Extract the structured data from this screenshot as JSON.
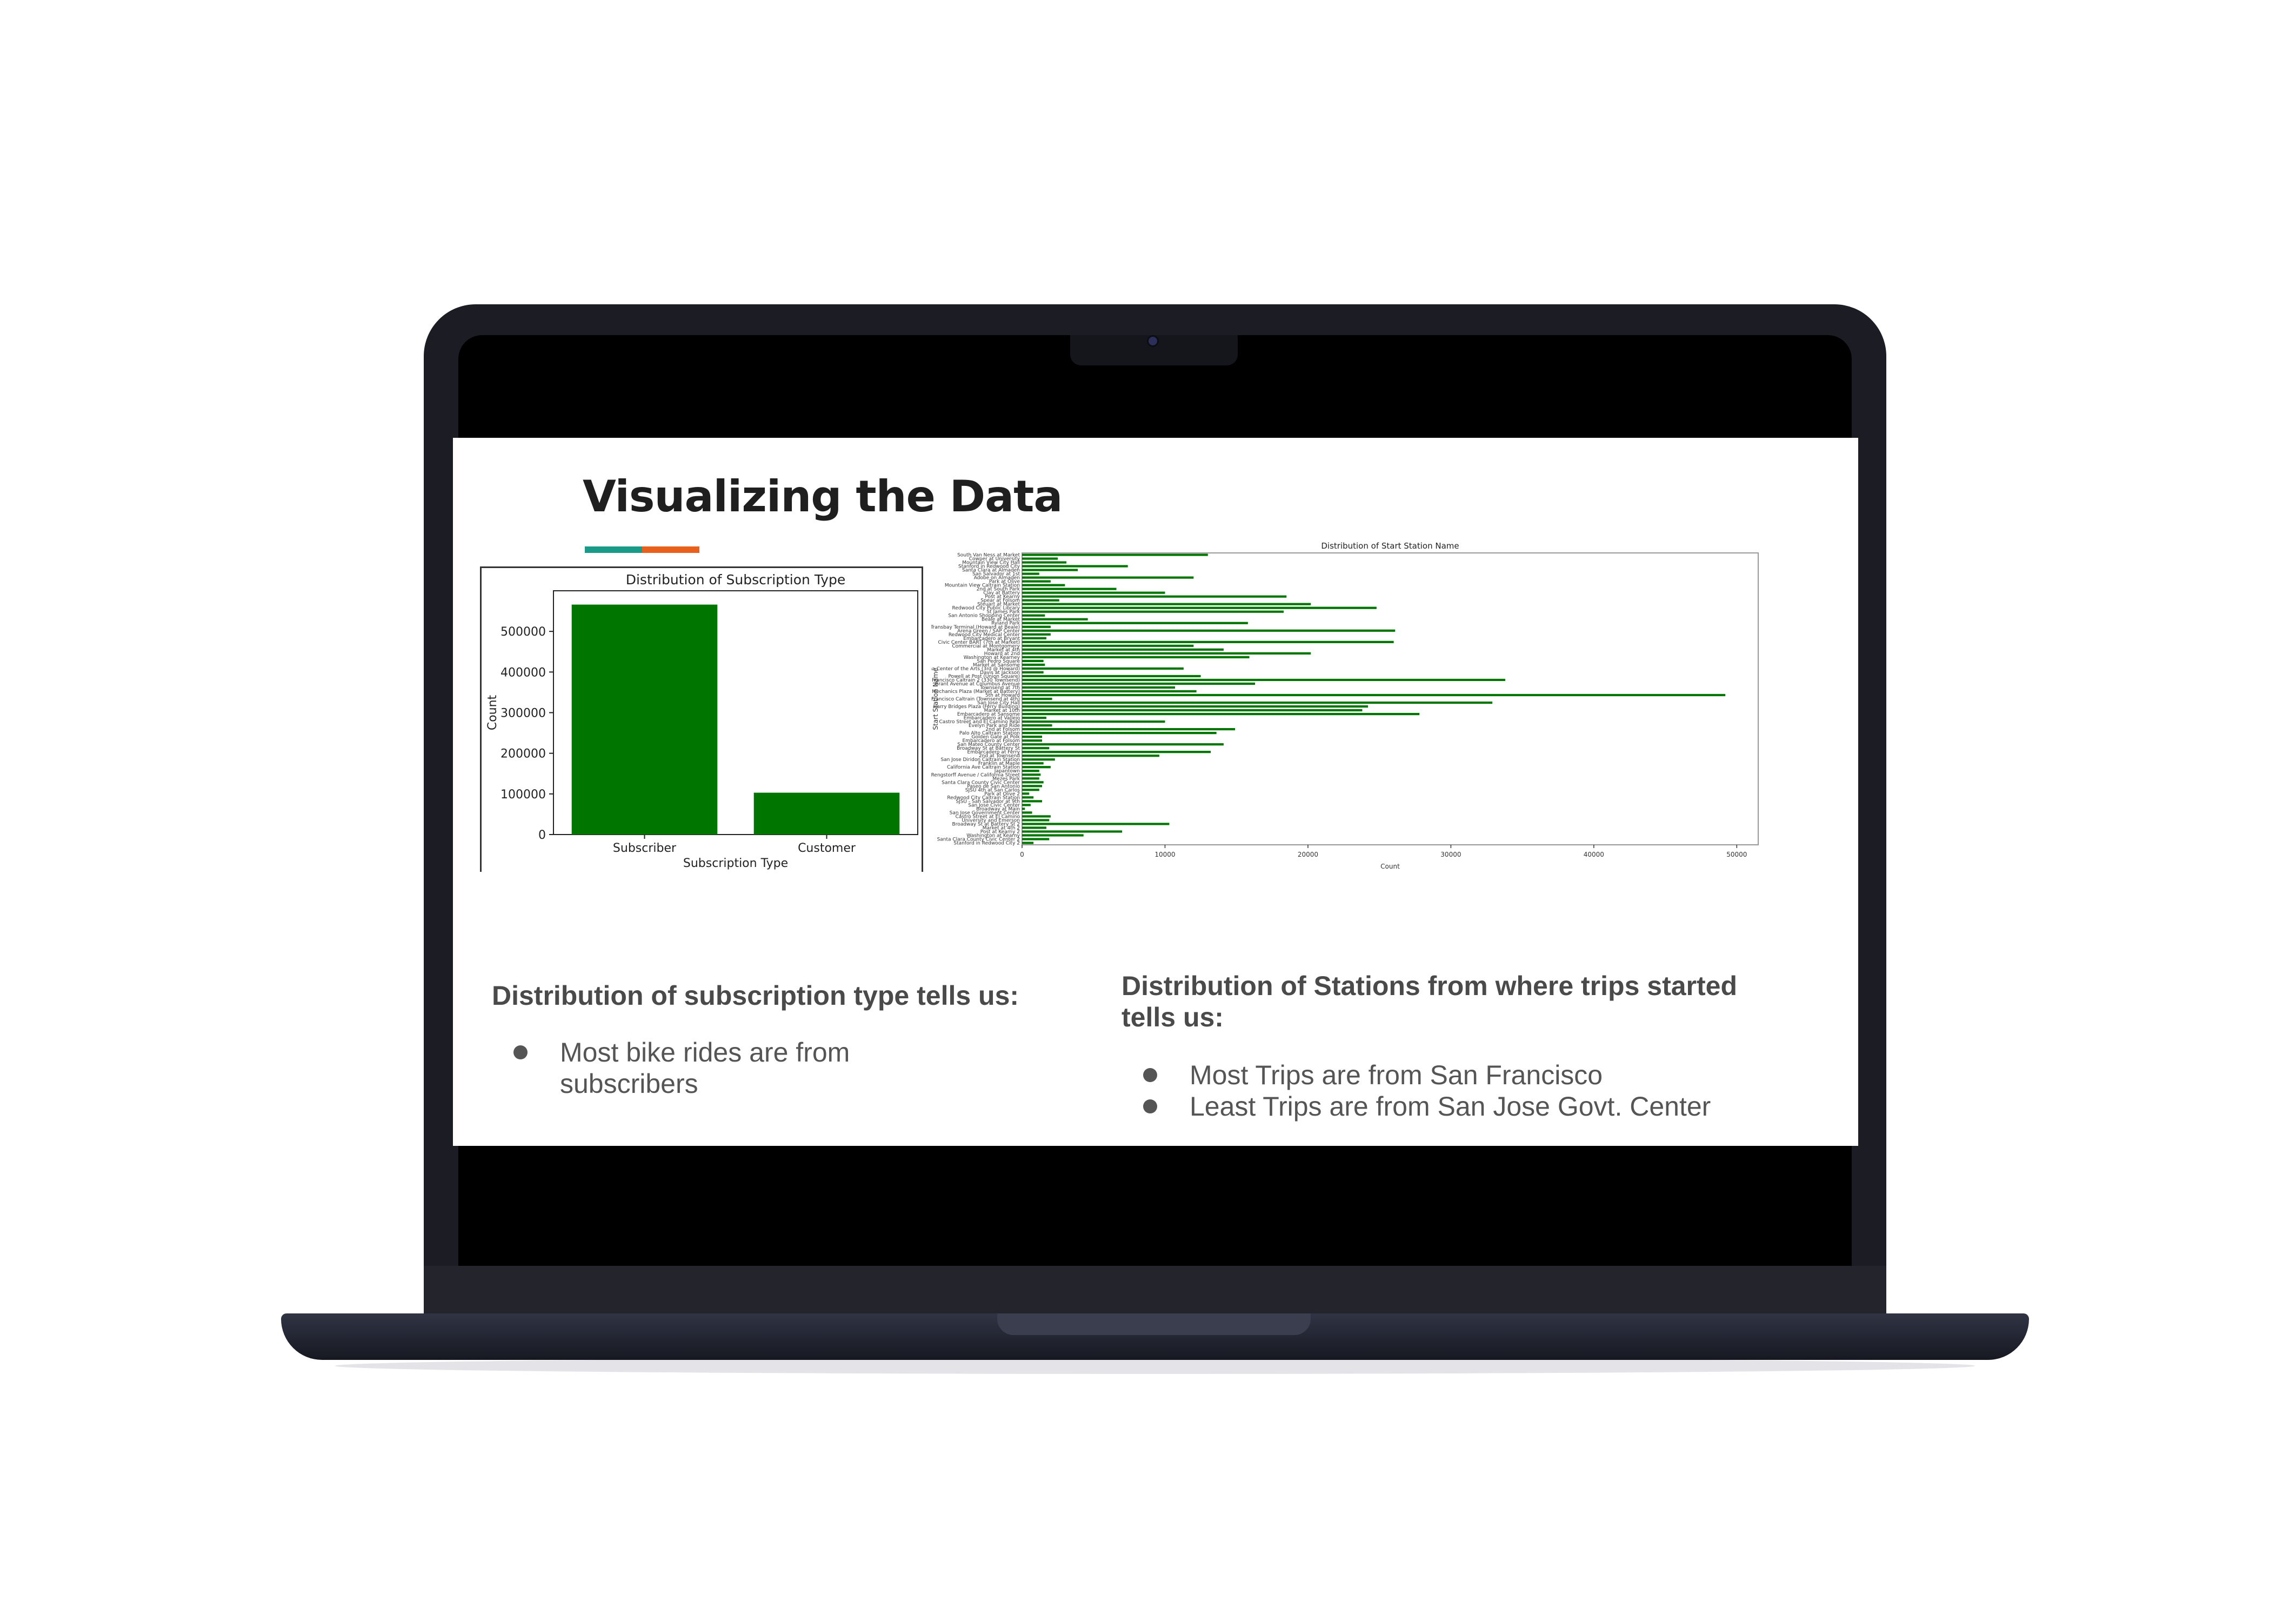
{
  "slide": {
    "title": "Visualizing the Data",
    "accent_colors": [
      "#1a9b8a",
      "#e8601c"
    ],
    "left_caption": "Distribution of subscription type tells us:",
    "left_bullets": [
      "Most bike rides are from subscribers"
    ],
    "right_caption": "Distribution of Stations from where trips started tells us:",
    "right_bullets": [
      "Most Trips are from San Francisco",
      "Least Trips are from San Jose Govt. Center"
    ]
  },
  "chart_data": [
    {
      "type": "bar",
      "title": "Distribution of Subscription Type",
      "xlabel": "Subscription Type",
      "ylabel": "Count",
      "categories": [
        "Subscriber",
        "Customer"
      ],
      "values": [
        566000,
        103000
      ],
      "ylim": [
        0,
        600000
      ],
      "yticks": [
        0,
        100000,
        200000,
        300000,
        400000,
        500000
      ],
      "color": "#007500"
    },
    {
      "type": "bar",
      "orientation": "horizontal",
      "title": "Distribution of Start Station Name",
      "xlabel": "Count",
      "ylabel": "Start Station Name",
      "xlim": [
        0,
        51500
      ],
      "xticks": [
        0,
        10000,
        20000,
        30000,
        40000,
        50000
      ],
      "color": "#007500",
      "categories": [
        "South Van Ness at Market",
        "Cowper at University",
        "Mountain View City Hall",
        "Stanford in Redwood City",
        "Santa Clara at Almaden",
        "San Salvador at 1st",
        "Adobe on Almaden",
        "Park at Olive",
        "Mountain View Caltrain Station",
        "2nd at South Park",
        "Clay at Battery",
        "Post at Kearny",
        "Spear at Folsom",
        "Steuart at Market",
        "Redwood City Public Library",
        "St James Park",
        "San Antonio Shopping Center",
        "Beale at Market",
        "Ryland Park",
        "Temporary Transbay Terminal (Howard at Beale)",
        "Arena Green / SAP Center",
        "Redwood City Medical Center",
        "Embarcadero at Bryant",
        "Civic Center BART (7th at Market)",
        "Commercial at Montgomery",
        "Market at 4th",
        "Howard at 2nd",
        "Washington at Kearney",
        "San Pedro Square",
        "Market at Sansome",
        "Yerba Buena Center of the Arts (3rd @ Howard)",
        "Davis at Jackson",
        "Powell at Post (Union Square)",
        "San Francisco Caltrain 2 (330 Townsend)",
        "Grant Avenue at Columbus Avenue",
        "Townsend at 7th",
        "Mechanics Plaza (Market at Battery)",
        "5th at Howard",
        "San Francisco Caltrain (Townsend at 4th)",
        "San Jose City Hall",
        "Harry Bridges Plaza (Ferry Building)",
        "Market at 10th",
        "Embarcadero at Sansome",
        "Embarcadero at Vallejo",
        "Castro Street and El Camino Real",
        "Evelyn Park and Ride",
        "2nd at Folsom",
        "Palo Alto Caltrain Station",
        "Golden Gate at Polk",
        "Embarcadero at Folsom",
        "San Mateo County Center",
        "Broadway St at Battery St",
        "Embarcadero at Ferry",
        "2nd at Townsend",
        "San Jose Diridon Caltrain Station",
        "Franklin at Maple",
        "California Ave Caltrain Station",
        "Japantown",
        "Rengstorff Avenue / California Street",
        "Mezes Park",
        "Santa Clara County Civic Center",
        "Paseo de San Antonio",
        "SJSU 4th at San Carlos",
        "Park at Olive 2",
        "Redwood City Caltrain Station",
        "SJSU - San Salvador at 9th",
        "San Jose Civic Center",
        "Broadway at Main",
        "San Jose Government Center",
        "Castro Street at El Camino",
        "University and Emerson",
        "Broadway St at Battery St 2",
        "Market at 4th 2",
        "Post at Kearny 2",
        "Washington at Kearny",
        "Santa Clara County Civic Center 2",
        "Stanford in Redwood City 2"
      ],
      "values": [
        13000,
        2500,
        3100,
        7400,
        3900,
        1200,
        12000,
        2000,
        3000,
        6600,
        10000,
        18500,
        2600,
        20200,
        24800,
        18300,
        1600,
        4600,
        15800,
        2000,
        26100,
        2000,
        1700,
        26000,
        12000,
        14100,
        20200,
        15900,
        1500,
        1600,
        11300,
        1500,
        12500,
        33800,
        16300,
        10700,
        12200,
        49200,
        2100,
        32900,
        24200,
        23800,
        27800,
        1700,
        10000,
        2100,
        14900,
        13600,
        1400,
        1400,
        14100,
        1900,
        13200,
        9600,
        2300,
        1500,
        2000,
        1200,
        1300,
        1200,
        1500,
        1400,
        1200,
        500,
        800,
        1400,
        600,
        200,
        700,
        2000,
        1900,
        10300,
        1700,
        7000,
        4300,
        1900,
        800
      ]
    }
  ]
}
